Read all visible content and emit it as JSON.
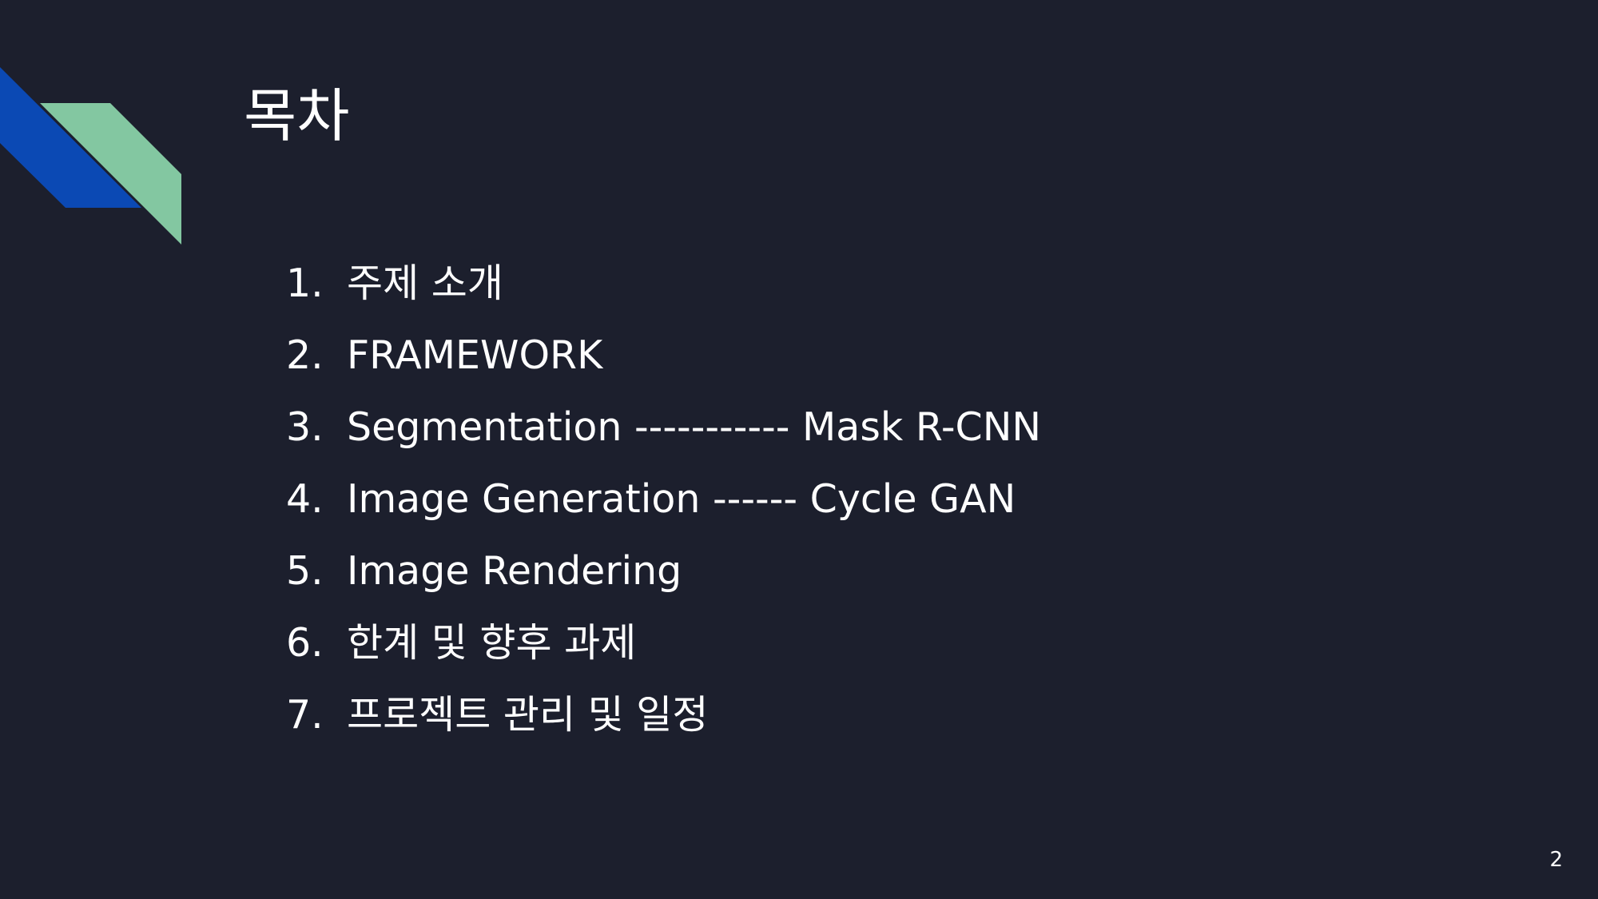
{
  "slide": {
    "title": "목차",
    "page_number": "2",
    "items": [
      {
        "number": "1.",
        "text": "주제 소개"
      },
      {
        "number": "2.",
        "text": "FRAMEWORK"
      },
      {
        "number": "3.",
        "text": "Segmentation ----------- Mask R-CNN"
      },
      {
        "number": "4.",
        "text": "Image Generation ------ Cycle GAN"
      },
      {
        "number": "5.",
        "text": "Image Rendering"
      },
      {
        "number": "6.",
        "text": "한계 및 향후 과제"
      },
      {
        "number": "7.",
        "text": "프로젝트 관리 및 일정"
      }
    ]
  },
  "colors": {
    "background": "#1c1f2d",
    "text": "#ffffff",
    "accent_blue": "#0b49b4",
    "accent_green": "#83c7a1"
  },
  "icons": {
    "decoration": "diagonal-stripes-decoration-icon"
  }
}
